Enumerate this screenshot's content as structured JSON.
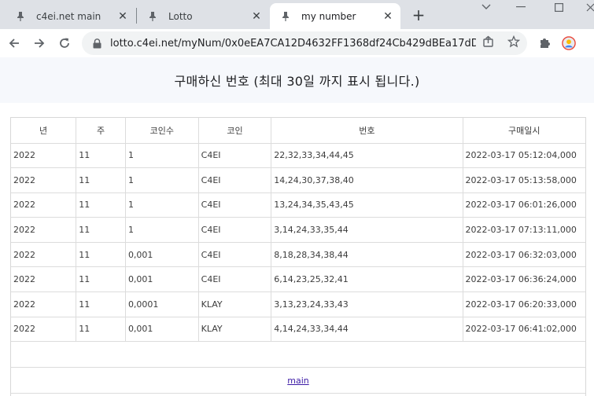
{
  "browser": {
    "tabs": [
      {
        "title": "c4ei.net main",
        "favicon": "pin-icon",
        "active": false
      },
      {
        "title": "Lotto",
        "favicon": "pin-icon",
        "active": false
      },
      {
        "title": "my number",
        "favicon": "pin-icon",
        "active": true
      }
    ],
    "new_tab_symbol": "+",
    "close_symbol": "✕",
    "address": "lotto.c4ei.net/myNum/0x0eEA7CA12D4632FF1368df24Cb429dBEa17dD..."
  },
  "page": {
    "heading": "구매하신 번호 (최대 30일 까지 표시 됩니다.)",
    "table": {
      "headers": [
        "년",
        "주",
        "코인수",
        "코인",
        "번호",
        "구매일시"
      ],
      "rows": [
        [
          "2022",
          "11",
          "1",
          "C4EI",
          "22,32,33,34,44,45",
          "2022-03-17 05:12:04,000"
        ],
        [
          "2022",
          "11",
          "1",
          "C4EI",
          "14,24,30,37,38,40",
          "2022-03-17 05:13:58,000"
        ],
        [
          "2022",
          "11",
          "1",
          "C4EI",
          "13,24,34,35,43,45",
          "2022-03-17 06:01:26,000"
        ],
        [
          "2022",
          "11",
          "1",
          "C4EI",
          "3,14,24,33,35,44",
          "2022-03-17 07:13:11,000"
        ],
        [
          "2022",
          "11",
          "0,001",
          "C4EI",
          "8,18,28,34,38,44",
          "2022-03-17 06:32:03,000"
        ],
        [
          "2022",
          "11",
          "0,001",
          "C4EI",
          "6,14,23,25,32,41",
          "2022-03-17 06:36:24,000"
        ],
        [
          "2022",
          "11",
          "0,0001",
          "KLAY",
          "3,13,23,24,33,43",
          "2022-03-17 06:20:33,000"
        ],
        [
          "2022",
          "11",
          "0,001",
          "KLAY",
          "4,14,24,33,34,44",
          "2022-03-17 06:41:02,000"
        ]
      ]
    },
    "footer_link": "main"
  }
}
